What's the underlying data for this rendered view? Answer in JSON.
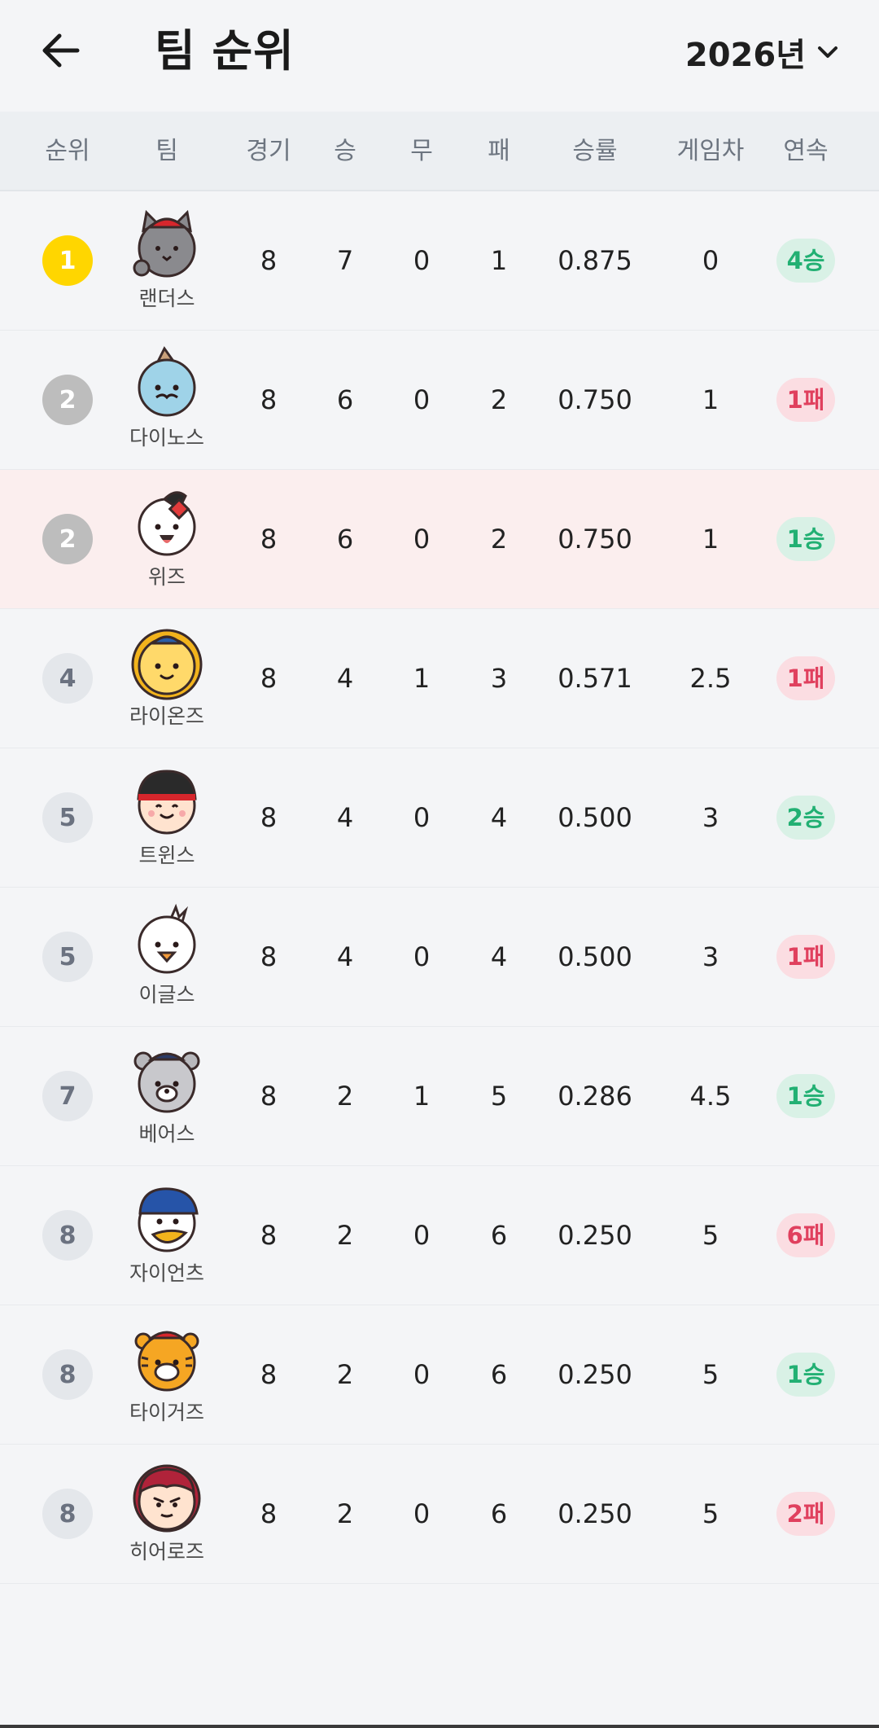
{
  "header": {
    "title": "팀 순위",
    "year": "2026년"
  },
  "columns": {
    "rank": "순위",
    "team": "팀",
    "games": "경기",
    "wins": "승",
    "draws": "무",
    "losses": "패",
    "pct": "승률",
    "gb": "게임차",
    "streak": "연속"
  },
  "teams": [
    {
      "rank": "1",
      "name": "랜더스",
      "games": "8",
      "wins": "7",
      "draws": "0",
      "losses": "1",
      "pct": "0.875",
      "gb": "0",
      "streak": "4승",
      "streak_type": "win",
      "badge": "gold",
      "mascot": "grey-cat",
      "highlight": false
    },
    {
      "rank": "2",
      "name": "다이노스",
      "games": "8",
      "wins": "6",
      "draws": "0",
      "losses": "2",
      "pct": "0.750",
      "gb": "1",
      "streak": "1패",
      "streak_type": "loss",
      "badge": "silver",
      "mascot": "blue-dino",
      "highlight": false
    },
    {
      "rank": "2",
      "name": "위즈",
      "games": "8",
      "wins": "6",
      "draws": "0",
      "losses": "2",
      "pct": "0.750",
      "gb": "1",
      "streak": "1승",
      "streak_type": "win",
      "badge": "silver",
      "mascot": "white-bird",
      "highlight": true
    },
    {
      "rank": "4",
      "name": "라이온즈",
      "games": "8",
      "wins": "4",
      "draws": "1",
      "losses": "3",
      "pct": "0.571",
      "gb": "2.5",
      "streak": "1패",
      "streak_type": "loss",
      "badge": "plain",
      "mascot": "yellow-lion",
      "highlight": false
    },
    {
      "rank": "5",
      "name": "트윈스",
      "games": "8",
      "wins": "4",
      "draws": "0",
      "losses": "4",
      "pct": "0.500",
      "gb": "3",
      "streak": "2승",
      "streak_type": "win",
      "badge": "plain",
      "mascot": "boy-cap",
      "highlight": false
    },
    {
      "rank": "5",
      "name": "이글스",
      "games": "8",
      "wins": "4",
      "draws": "0",
      "losses": "4",
      "pct": "0.500",
      "gb": "3",
      "streak": "1패",
      "streak_type": "loss",
      "badge": "plain",
      "mascot": "white-chick",
      "highlight": false
    },
    {
      "rank": "7",
      "name": "베어스",
      "games": "8",
      "wins": "2",
      "draws": "1",
      "losses": "5",
      "pct": "0.286",
      "gb": "4.5",
      "streak": "1승",
      "streak_type": "win",
      "badge": "plain",
      "mascot": "grey-bear",
      "highlight": false
    },
    {
      "rank": "8",
      "name": "자이언츠",
      "games": "8",
      "wins": "2",
      "draws": "0",
      "losses": "6",
      "pct": "0.250",
      "gb": "5",
      "streak": "6패",
      "streak_type": "loss",
      "badge": "plain",
      "mascot": "seagull-cap",
      "highlight": false
    },
    {
      "rank": "8",
      "name": "타이거즈",
      "games": "8",
      "wins": "2",
      "draws": "0",
      "losses": "6",
      "pct": "0.250",
      "gb": "5",
      "streak": "1승",
      "streak_type": "win",
      "badge": "plain",
      "mascot": "orange-tiger",
      "highlight": false
    },
    {
      "rank": "8",
      "name": "히어로즈",
      "games": "8",
      "wins": "2",
      "draws": "0",
      "losses": "6",
      "pct": "0.250",
      "gb": "5",
      "streak": "2패",
      "streak_type": "loss",
      "badge": "plain",
      "mascot": "red-hero",
      "highlight": false
    }
  ],
  "colors": {
    "gold": "#ffd600",
    "silver": "#bdbdbd",
    "win_text": "#22b073",
    "win_bg": "#d9f1e6",
    "loss_text": "#e0405e",
    "loss_bg": "#fbdde2",
    "highlight_row": "#fbeeee"
  }
}
